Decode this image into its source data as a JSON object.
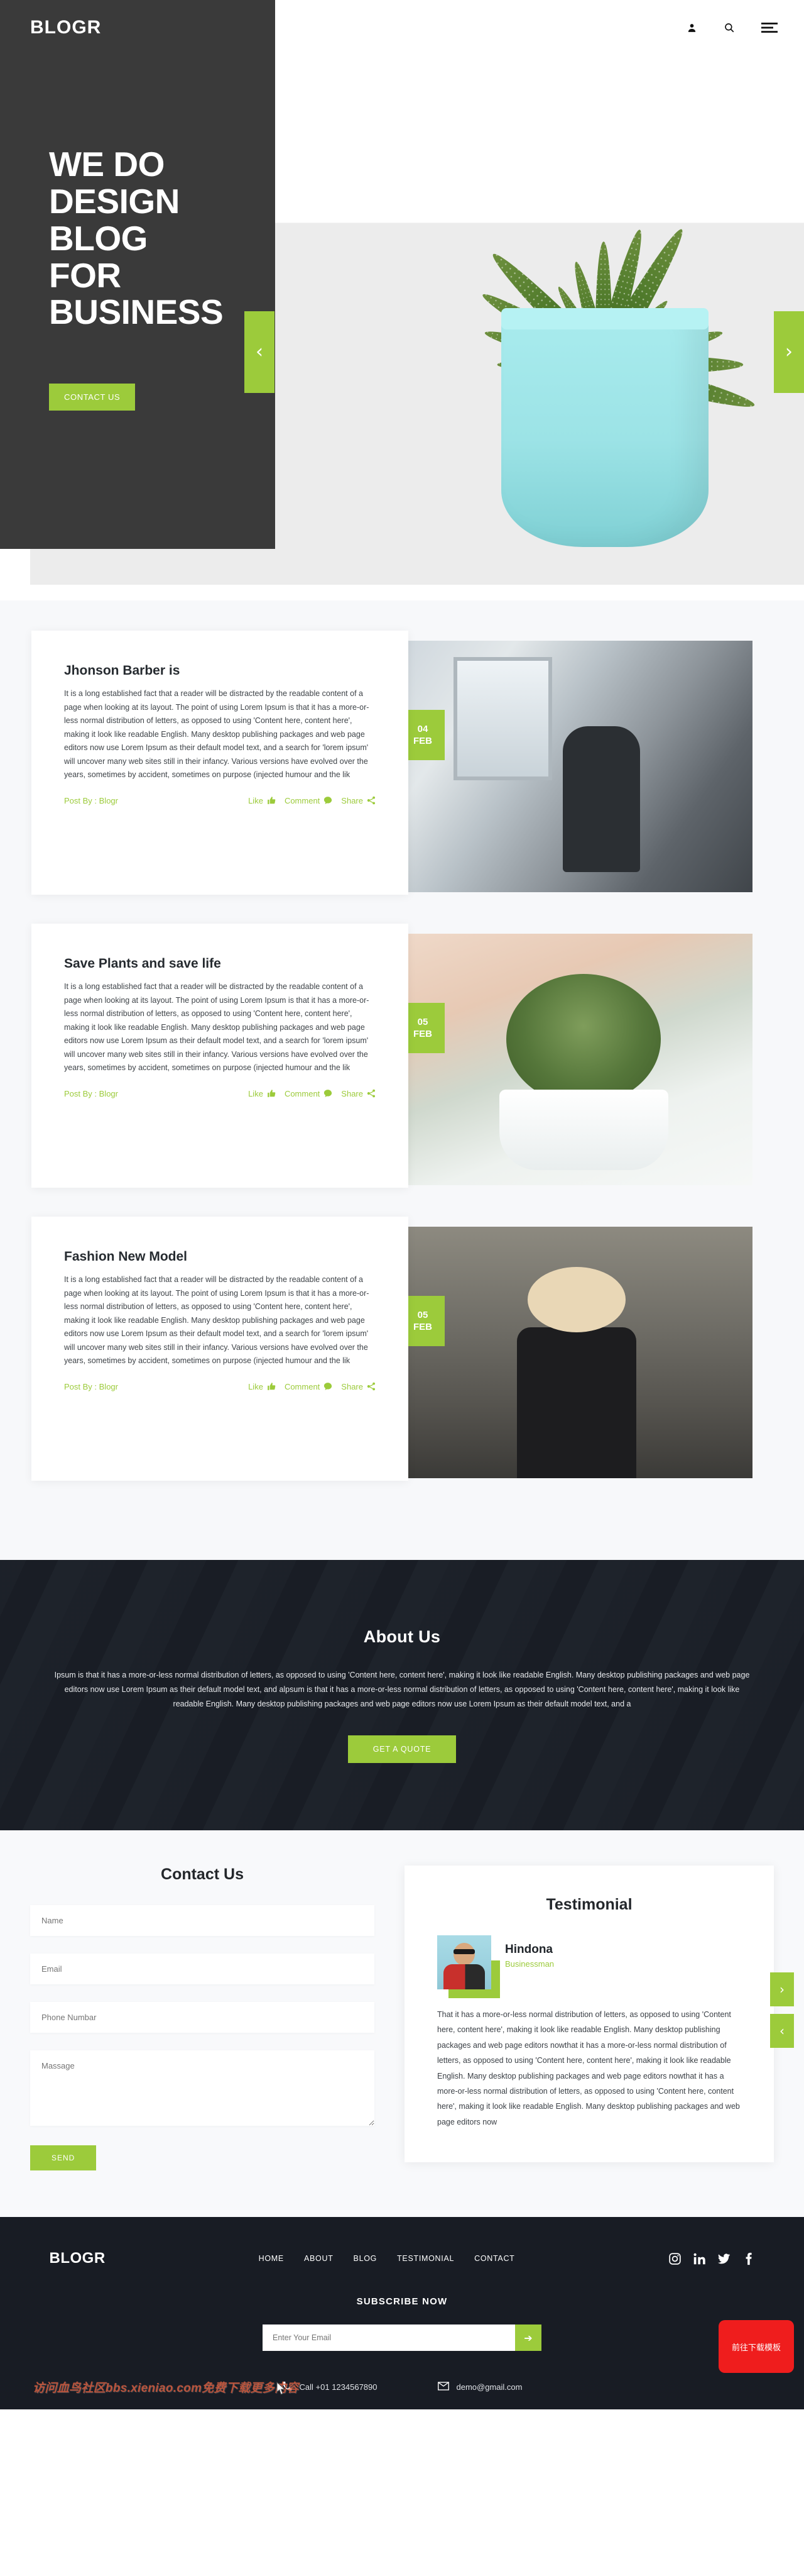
{
  "header": {
    "brand": "BLOGR",
    "icons": [
      "user-icon",
      "search-icon",
      "hamburger-menu-icon"
    ]
  },
  "hero": {
    "title_lines": [
      "WE DO",
      "DESIGN",
      "BLOG",
      "FOR",
      "BUSINESS"
    ],
    "cta_label": "CONTACT US",
    "prev_arrow": "‹",
    "next_arrow": "›",
    "accent_color": "#9ccb3b",
    "panel_color": "#3a3a3a"
  },
  "posts": [
    {
      "title": "Jhonson Barber is",
      "body": "It is a long established fact that a reader will be distracted by the readable content of a page when looking at its layout. The point of using Lorem Ipsum is that it has a more-or-less normal distribution of letters, as opposed to using 'Content here, content here', making it look like readable English. Many desktop publishing packages and web page editors now use Lorem Ipsum as their default model text, and a search for 'lorem ipsum' will uncover many web sites still in their infancy. Various versions have evolved over the years, sometimes by accident, sometimes on purpose (injected humour and the lik",
      "post_by": "Post By : Blogr",
      "like": "Like",
      "comment": "Comment",
      "share": "Share",
      "date_day": "04",
      "date_month": "FEB",
      "image": "salon-photo"
    },
    {
      "title": "Save Plants and save life",
      "body": "It is a long established fact that a reader will be distracted by the readable content of a page when looking at its layout. The point of using Lorem Ipsum is that it has a more-or-less normal distribution of letters, as opposed to using 'Content here, content here', making it look like readable English. Many desktop publishing packages and web page editors now use Lorem Ipsum as their default model text, and a search for 'lorem ipsum' will uncover many web sites still in their infancy. Various versions have evolved over the years, sometimes by accident, sometimes on purpose (injected humour and the lik",
      "post_by": "Post By : Blogr",
      "like": "Like",
      "comment": "Comment",
      "share": "Share",
      "date_day": "05",
      "date_month": "FEB",
      "image": "plant-photo"
    },
    {
      "title": "Fashion New Model",
      "body": "It is a long established fact that a reader will be distracted by the readable content of a page when looking at its layout. The point of using Lorem Ipsum is that it has a more-or-less normal distribution of letters, as opposed to using 'Content here, content here', making it look like readable English. Many desktop publishing packages and web page editors now use Lorem Ipsum as their default model text, and a search for 'lorem ipsum' will uncover many web sites still in their infancy. Various versions have evolved over the years, sometimes by accident, sometimes on purpose (injected humour and the lik",
      "post_by": "Post By : Blogr",
      "like": "Like",
      "comment": "Comment",
      "share": "Share",
      "date_day": "05",
      "date_month": "FEB",
      "image": "fashion-photo"
    }
  ],
  "about": {
    "title": "About Us",
    "text": "Ipsum is that it has a more-or-less normal distribution of letters, as opposed to using 'Content here, content here', making it look like readable English. Many desktop publishing packages and web page editors now use Lorem Ipsum as their default model text, and alpsum is that it has a more-or-less normal distribution of letters, as opposed to using 'Content here, content here', making it look like readable English. Many desktop publishing packages and web page editors now use Lorem Ipsum as their default model text, and a",
    "button_label": "GET A QUOTE"
  },
  "contact": {
    "title": "Contact Us",
    "name_placeholder": "Name",
    "email_placeholder": "Email",
    "phone_placeholder": "Phone Numbar",
    "message_placeholder": "Massage",
    "send_label": "SEND"
  },
  "testimonial": {
    "title": "Testimonial",
    "name": "Hindona",
    "role": "Businessman",
    "text": "That it has a more-or-less normal distribution of letters, as opposed to using 'Content here, content here', making it look like readable English. Many desktop publishing packages and web page editors nowthat it has a more-or-less normal distribution of letters, as opposed to using 'Content here, content here', making it look like readable English. Many desktop publishing packages and web page editors nowthat it has a more-or-less normal distribution of letters, as opposed to using 'Content here, content here', making it look like readable English. Many desktop publishing packages and web page editors now",
    "next_arrow": "›",
    "prev_arrow": "‹"
  },
  "footer": {
    "brand": "BLOGR",
    "nav": [
      "HOME",
      "ABOUT",
      "BLOG",
      "TESTIMONIAL",
      "CONTACT"
    ],
    "social": [
      "instagram-icon",
      "linkedin-icon",
      "twitter-icon",
      "facebook-icon"
    ],
    "subscribe_title": "SUBSCRIBE NOW",
    "subscribe_placeholder": "Enter Your Email",
    "subscribe_arrow": "➔",
    "phone": "Call +01 1234567890",
    "email": "demo@gmail.com",
    "watermark": "访问血鸟社区bbs.xieniao.com免费下载更多内容",
    "download_badge": "前往下载模板"
  }
}
